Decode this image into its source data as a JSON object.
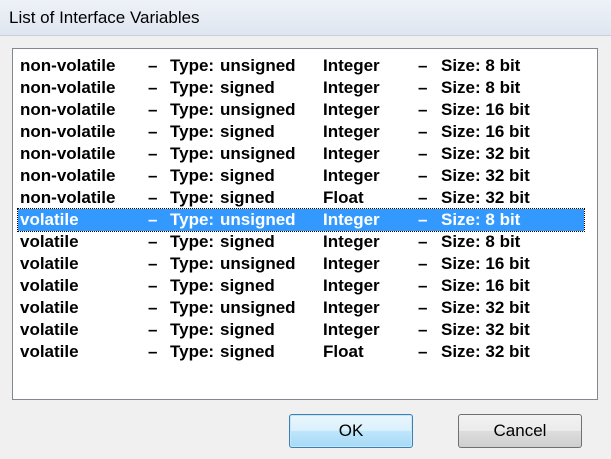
{
  "window": {
    "title": "List of Interface Variables"
  },
  "list": {
    "selected_index": 7,
    "rows": [
      {
        "volatility": "non-volatile",
        "sep1": "–",
        "type_label": "Type:",
        "signedness": "unsigned",
        "data_type": "Integer",
        "sep2": "–",
        "size": "Size: 8 bit"
      },
      {
        "volatility": "non-volatile",
        "sep1": "–",
        "type_label": "Type:",
        "signedness": "signed",
        "data_type": "Integer",
        "sep2": "–",
        "size": "Size: 8 bit"
      },
      {
        "volatility": "non-volatile",
        "sep1": "–",
        "type_label": "Type:",
        "signedness": "unsigned",
        "data_type": "Integer",
        "sep2": "–",
        "size": "Size: 16 bit"
      },
      {
        "volatility": "non-volatile",
        "sep1": "–",
        "type_label": "Type:",
        "signedness": "signed",
        "data_type": "Integer",
        "sep2": "–",
        "size": "Size: 16 bit"
      },
      {
        "volatility": "non-volatile",
        "sep1": "–",
        "type_label": "Type:",
        "signedness": "unsigned",
        "data_type": "Integer",
        "sep2": "–",
        "size": "Size: 32 bit"
      },
      {
        "volatility": "non-volatile",
        "sep1": "–",
        "type_label": "Type:",
        "signedness": "signed",
        "data_type": "Integer",
        "sep2": "–",
        "size": "Size: 32 bit"
      },
      {
        "volatility": "non-volatile",
        "sep1": "–",
        "type_label": "Type:",
        "signedness": "signed",
        "data_type": "Float",
        "sep2": "–",
        "size": "Size: 32 bit"
      },
      {
        "volatility": "volatile",
        "sep1": "–",
        "type_label": "Type:",
        "signedness": "unsigned",
        "data_type": "Integer",
        "sep2": "–",
        "size": "Size: 8 bit"
      },
      {
        "volatility": "volatile",
        "sep1": "–",
        "type_label": "Type:",
        "signedness": "signed",
        "data_type": "Integer",
        "sep2": "–",
        "size": "Size: 8 bit"
      },
      {
        "volatility": "volatile",
        "sep1": "–",
        "type_label": "Type:",
        "signedness": "unsigned",
        "data_type": "Integer",
        "sep2": "–",
        "size": "Size: 16 bit"
      },
      {
        "volatility": "volatile",
        "sep1": "–",
        "type_label": "Type:",
        "signedness": "signed",
        "data_type": "Integer",
        "sep2": "–",
        "size": "Size: 16 bit"
      },
      {
        "volatility": "volatile",
        "sep1": "–",
        "type_label": "Type:",
        "signedness": "unsigned",
        "data_type": "Integer",
        "sep2": "–",
        "size": "Size: 32 bit"
      },
      {
        "volatility": "volatile",
        "sep1": "–",
        "type_label": "Type:",
        "signedness": "signed",
        "data_type": "Integer",
        "sep2": "–",
        "size": "Size: 32 bit"
      },
      {
        "volatility": "volatile",
        "sep1": "–",
        "type_label": "Type:",
        "signedness": "signed",
        "data_type": "Float",
        "sep2": "–",
        "size": "Size: 32 bit"
      }
    ]
  },
  "buttons": {
    "ok_label": "OK",
    "cancel_label": "Cancel"
  },
  "colors": {
    "selection": "#3399ff",
    "dialog_bg": "#f0f0f0"
  }
}
